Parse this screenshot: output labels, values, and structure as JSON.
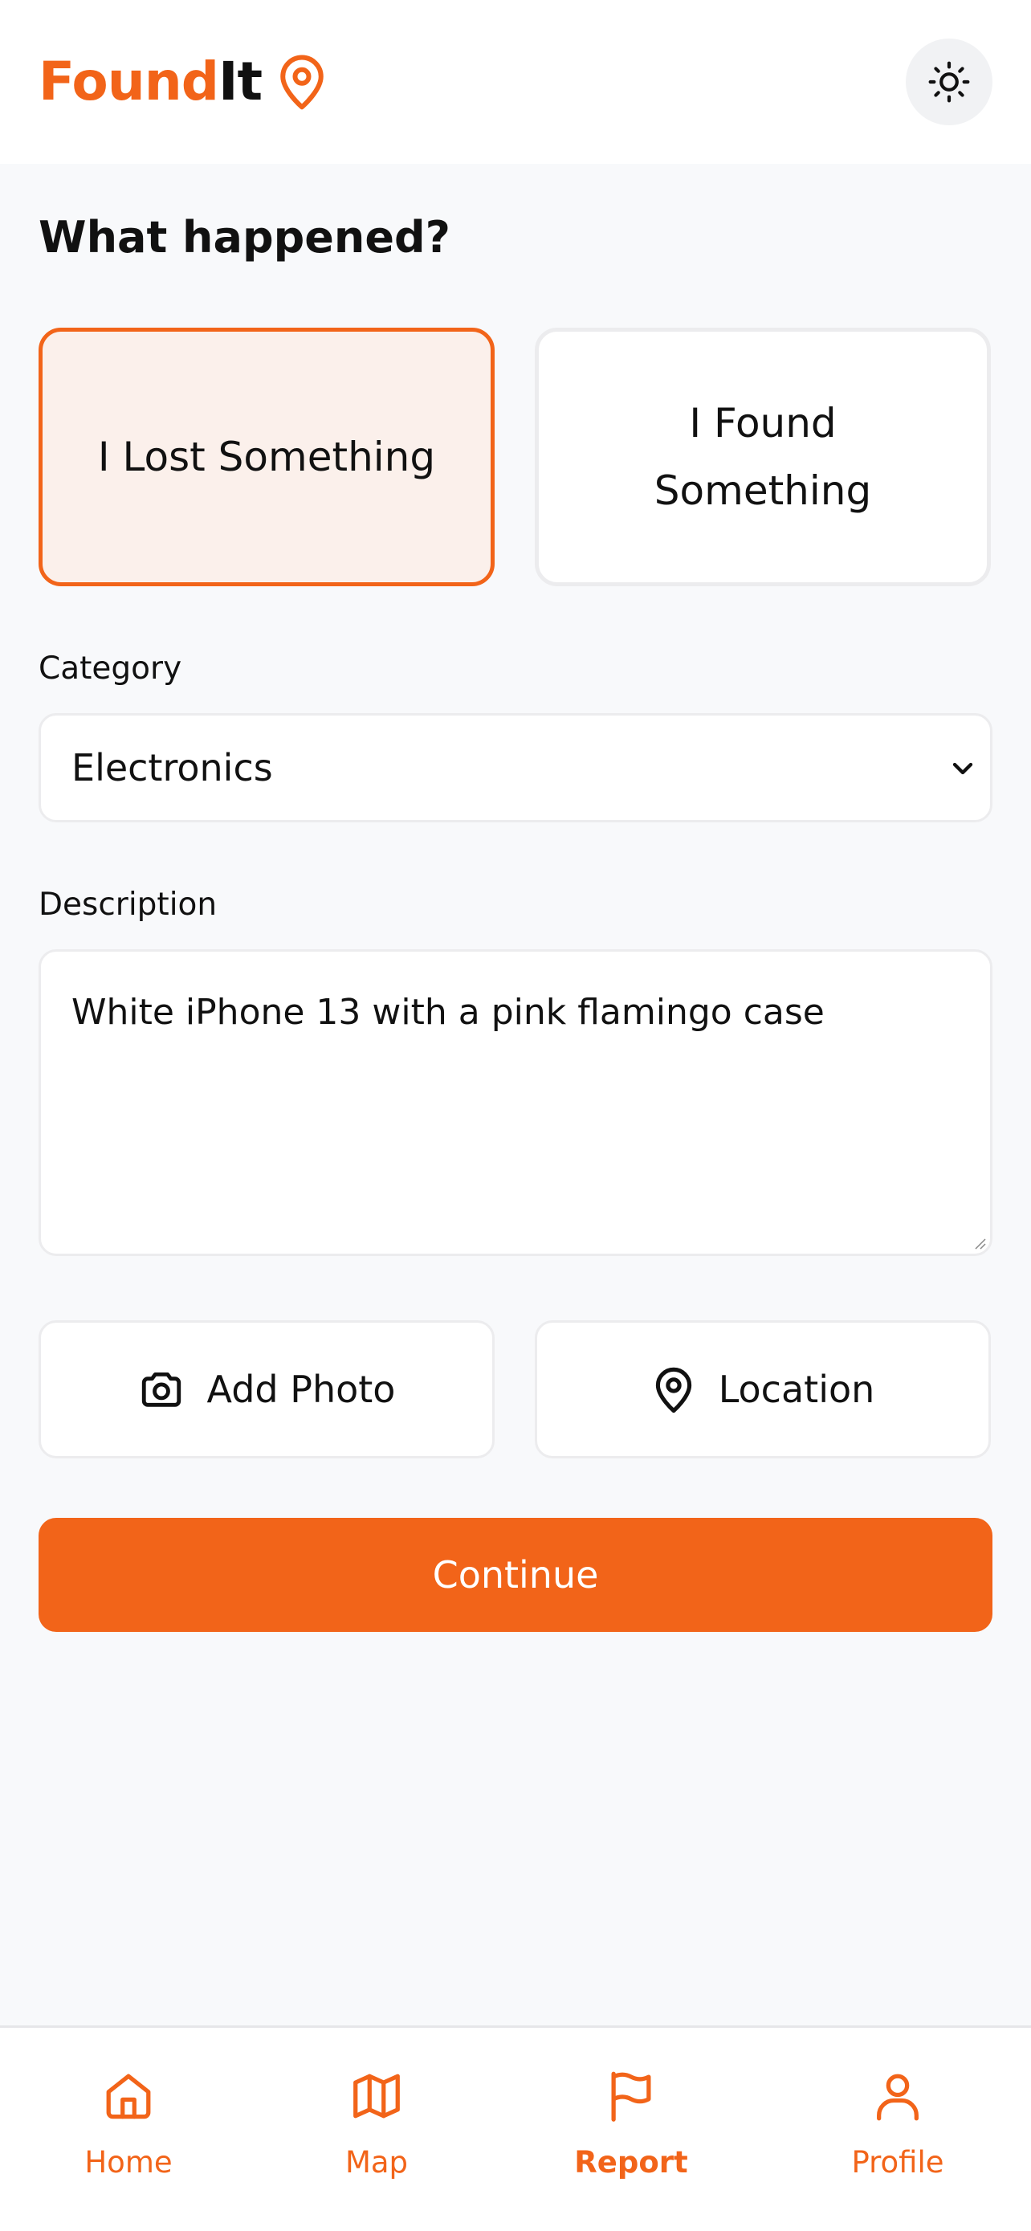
{
  "header": {
    "logo_part1": "Found",
    "logo_part2": "It",
    "logo_icon": "map-pin-icon",
    "theme_icon": "sun-icon"
  },
  "form": {
    "title": "What happened?",
    "choices": [
      {
        "label": "I Lost Something",
        "selected": true
      },
      {
        "label": "I Found Something",
        "selected": false
      }
    ],
    "category": {
      "label": "Category",
      "value": "Electronics"
    },
    "description": {
      "label": "Description",
      "value": "White iPhone 13 with a pink flamingo case"
    },
    "add_photo_label": "Add Photo",
    "location_label": "Location",
    "continue_label": "Continue"
  },
  "nav": {
    "items": [
      {
        "label": "Home",
        "icon": "home-icon",
        "active": false
      },
      {
        "label": "Map",
        "icon": "map-icon",
        "active": false
      },
      {
        "label": "Report",
        "icon": "flag-icon",
        "active": true
      },
      {
        "label": "Profile",
        "icon": "user-icon",
        "active": false
      }
    ]
  },
  "colors": {
    "accent": "#f26419",
    "selected_bg": "#fbf0eb",
    "page_bg": "#f8f9fb"
  }
}
